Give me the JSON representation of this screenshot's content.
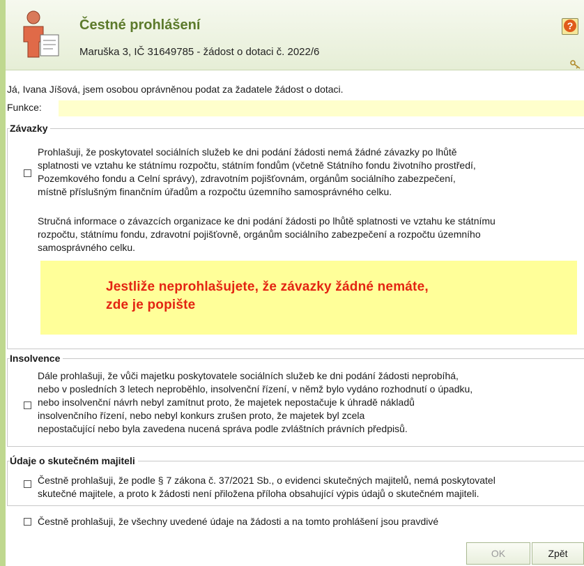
{
  "header": {
    "title": "Čestné prohlášení",
    "subtitle": "Maruška 3, IČ 31649785 - žádost o dotaci č. 2022/6",
    "help_glyph": "?",
    "icons": [
      "person-form-icon",
      "help-icon",
      "key-icon"
    ]
  },
  "intro": {
    "statement": "Já, Ivana Jíšová, jsem osobou oprávněnou podat za žadatele žádost o dotaci.",
    "funkce_label": "Funkce:",
    "funkce_value": ""
  },
  "zavazky": {
    "title": "Závazky",
    "declaration_lines": [
      "Prohlašuji, že poskytovatel sociálních služeb ke dni podání žádosti nemá žádné závazky po lhůtě",
      "splatnosti ve vztahu ke státnímu rozpočtu, státním fondům (včetně Státního fondu životního prostředí,",
      "Pozemkového fondu a Celní správy), zdravotním pojišťovnám, orgánům sociálního zabezpečení,",
      "místně příslušným finančním úřadům a rozpočtu územního samosprávného celku."
    ],
    "info_lines": [
      "Stručná informace o závazcích organizace ke dni podání žádosti po lhůtě splatnosti ve vztahu ke státnímu",
      "rozpočtu, státnímu fondu, zdravotní pojišťovně, orgánům sociálního zabezpečení a rozpočtu územního",
      "samosprávného celku."
    ],
    "textarea_hint": "Jestliže neprohlašujete, že závazky žádné nemáte,\nzde je popište",
    "checked": false
  },
  "insolvence": {
    "title": "Insolvence",
    "lines": [
      "Dále prohlašuji, že vůči majetku poskytovatele sociálních služeb ke dni podání žádosti neprobíhá,",
      "nebo v posledních 3 letech neproběhlo, insolvenční řízení, v němž bylo vydáno rozhodnutí o úpadku,",
      "nebo insolvenční návrh nebyl zamítnut proto, že majetek nepostačuje k úhradě nákladů",
      "insolvenčního řízení, nebo nebyl konkurs zrušen proto, že majetek byl zcela",
      "nepostačující nebo byla zavedena nucená správa podle zvláštních právních předpisů."
    ],
    "checked": false
  },
  "majitel": {
    "title": "Údaje o skutečném majiteli",
    "lines": [
      "Čestně prohlašuji, že podle § 7 zákona č. 37/2021 Sb., o evidenci skutečných majitelů, nemá poskytovatel",
      "skutečné majitele, a proto k žádosti není přiložena příloha obsahující výpis údajů o skutečném majiteli."
    ],
    "checked": false
  },
  "final": {
    "text": "Čestně prohlašuji, že všechny uvedené údaje na žádosti a na tomto prohlášení jsou pravdivé",
    "checked": false
  },
  "buttons": {
    "ok": "OK",
    "back": "Zpět"
  },
  "colors": {
    "title_green": "#5c7a2b",
    "field_yellow": "#ffffcc",
    "textarea_yellow": "#ffff99",
    "warning_red": "#e32412",
    "left_strip": "#bfd88f"
  }
}
